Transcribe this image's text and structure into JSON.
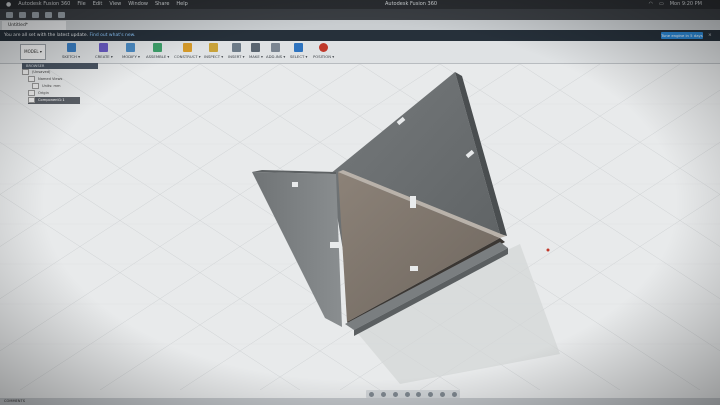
{
  "menubar": {
    "apple": "",
    "app_name": "Autodesk Fusion 360",
    "items": [
      "File",
      "Edit",
      "View",
      "Window",
      "Share",
      "Help"
    ],
    "window_title": "Autodesk Fusion 360",
    "clock": "Mon 9:20 PM"
  },
  "tab": {
    "label": "Untitled*"
  },
  "banner": {
    "message": "You are all set with the latest update. ",
    "link": "Find out what's new.",
    "button": "Tune engine in 5 days",
    "close": "×"
  },
  "toolbar": {
    "workspace": "MODEL ▾",
    "groups": [
      {
        "label": "SKETCH ▾",
        "color": "#3b7fc4"
      },
      {
        "label": "CREATE ▾",
        "color": "#6a5bc4"
      },
      {
        "label": "MODIFY ▾",
        "color": "#4b8bc4"
      },
      {
        "label": "ASSEMBLE ▾",
        "color": "#3d9f6a"
      },
      {
        "label": "CONSTRUCT ▾",
        "color": "#d59a2a"
      },
      {
        "label": "INSPECT ▾",
        "color": "#c8a23a"
      },
      {
        "label": "INSERT ▾",
        "color": "#6d7b88"
      },
      {
        "label": "MAKE ▾",
        "color": "#5a6570"
      },
      {
        "label": "ADD-INS ▾",
        "color": "#7b8591"
      },
      {
        "label": "SELECT ▾",
        "color": "#2e74c0"
      },
      {
        "label": "POSITION ▾",
        "color": "#c0392b"
      }
    ]
  },
  "browser": {
    "header": "BROWSER",
    "items": [
      {
        "label": "(Unsaved)",
        "selected": false
      },
      {
        "label": "Named Views",
        "selected": false
      },
      {
        "label": "Units: mm",
        "selected": false
      },
      {
        "label": "Origin",
        "selected": false
      },
      {
        "label": "Component1:1",
        "selected": true
      }
    ]
  },
  "status": {
    "comments": "COMMENTS"
  },
  "colors": {
    "banner_bg": "#26303a",
    "accent": "#2d8ad8",
    "grid": "#cfd2d4"
  }
}
